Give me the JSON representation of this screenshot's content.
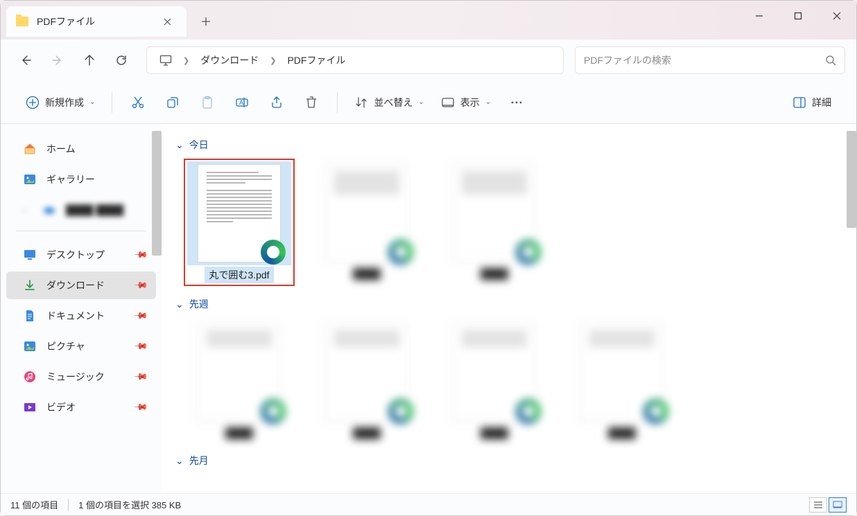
{
  "tab": {
    "title": "PDFファイル"
  },
  "path": {
    "seg1": "ダウンロード",
    "seg2": "PDFファイル"
  },
  "search": {
    "placeholder": "PDFファイルの検索"
  },
  "toolbar": {
    "new": "新規作成",
    "sort": "並べ替え",
    "view": "表示",
    "details": "詳細"
  },
  "sidebar": {
    "home": "ホーム",
    "gallery": "ギャラリー",
    "blurred1": "████ ████",
    "desktop": "デスクトップ",
    "downloads": "ダウンロード",
    "documents": "ドキュメント",
    "pictures": "ピクチャ",
    "music": "ミュージック",
    "videos": "ビデオ"
  },
  "groups": {
    "today": "今日",
    "lastweek": "先週",
    "lastmonth": "先月"
  },
  "files": {
    "selected": "丸で囲む3.pdf"
  },
  "status": {
    "count": "11 個の項目",
    "selection": "1 個の項目を選択 385 KB"
  }
}
